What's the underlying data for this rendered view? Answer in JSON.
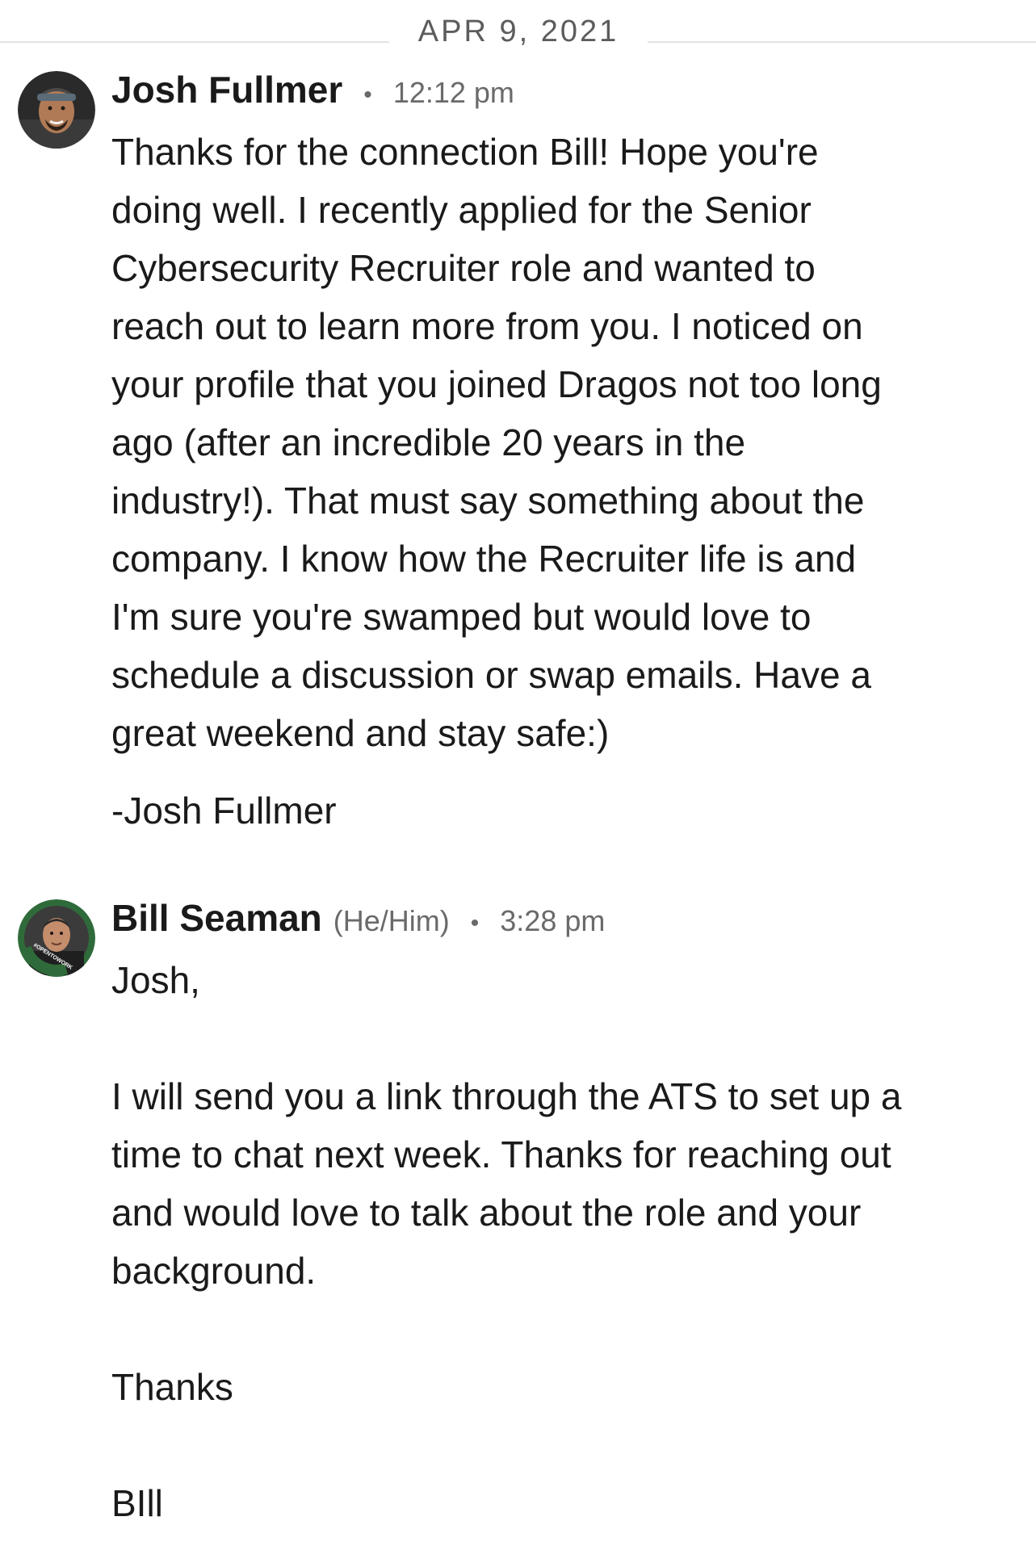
{
  "date_divider": "APR 9, 2021",
  "messages": [
    {
      "sender": "Josh Fullmer",
      "pronouns": "",
      "separator": "•",
      "time": "12:12 pm",
      "lines": [
        "Thanks for the connection Bill! Hope you're",
        "doing well. I recently applied for the Senior",
        "Cybersecurity Recruiter role and wanted to",
        "reach out to learn more from you. I noticed on",
        "your profile that you joined Dragos not too long",
        "ago (after an incredible 20 years in the",
        "industry!). That must say something about the",
        "company. I know how the Recruiter life is and",
        "I'm sure you're swamped but would love to",
        "schedule a discussion or swap emails. Have a",
        "great weekend and stay safe:)"
      ],
      "signature": "-Josh Fullmer"
    },
    {
      "sender": "Bill Seaman",
      "pronouns": "(He/Him)",
      "separator": "•",
      "time": "3:28 pm",
      "avatar_badge": "#OPENTOWORK",
      "greeting": "Josh,",
      "lines": [
        "I will send you a link through the ATS to set up a",
        "time to chat next week.  Thanks for reaching out",
        "and would love to talk about the role and your",
        "background."
      ],
      "closing": "Thanks",
      "signature": "BIll"
    }
  ],
  "colors": {
    "text": "#1a1a1a",
    "muted": "#6a6a6a",
    "divider": "#e3e3e3",
    "open_to_work_green": "#2f6b3a"
  },
  "icons": {
    "avatar_josh": "profile-photo",
    "avatar_bill": "profile-photo-open-to-work"
  }
}
